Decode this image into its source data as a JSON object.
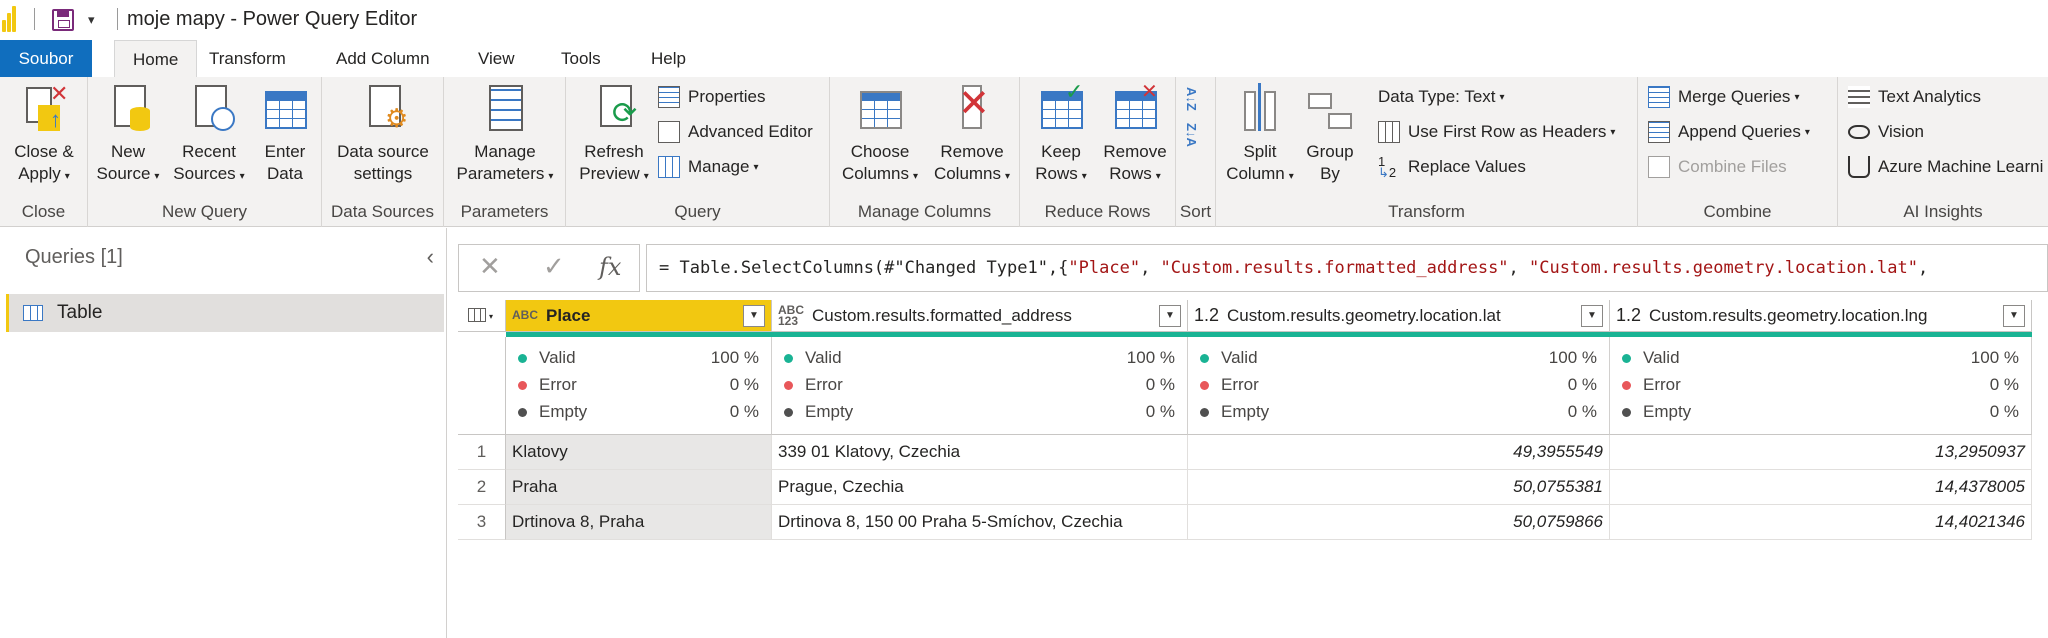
{
  "titlebar": {
    "title": "moje mapy - Power Query Editor",
    "dropdown_glyph": "▾"
  },
  "menu": {
    "tabs": [
      "Soubor",
      "Home",
      "Transform",
      "Add Column",
      "View",
      "Tools",
      "Help"
    ],
    "active": "Home"
  },
  "ribbon": {
    "close": {
      "label": "Close",
      "apply_l1": "Close &",
      "apply_l2": "Apply"
    },
    "new_query": {
      "label": "New Query",
      "new_l1": "New",
      "new_l2": "Source",
      "recent_l1": "Recent",
      "recent_l2": "Sources",
      "enter_l1": "Enter",
      "enter_l2": "Data"
    },
    "data_sources": {
      "label": "Data Sources",
      "btn_l1": "Data source",
      "btn_l2": "settings"
    },
    "parameters": {
      "label": "Parameters",
      "btn_l1": "Manage",
      "btn_l2": "Parameters"
    },
    "query": {
      "label": "Query",
      "refresh_l1": "Refresh",
      "refresh_l2": "Preview",
      "properties": "Properties",
      "advanced_editor": "Advanced Editor",
      "manage": "Manage"
    },
    "manage_columns": {
      "label": "Manage Columns",
      "choose_l1": "Choose",
      "choose_l2": "Columns",
      "remove_l1": "Remove",
      "remove_l2": "Columns"
    },
    "reduce_rows": {
      "label": "Reduce Rows",
      "keep_l1": "Keep",
      "keep_l2": "Rows",
      "remove_l1": "Remove",
      "remove_l2": "Rows"
    },
    "sort": {
      "label": "Sort",
      "az": "A↓Z",
      "za": "Z↓A"
    },
    "transform": {
      "label": "Transform",
      "split_l1": "Split",
      "split_l2": "Column",
      "group_l1": "Group",
      "group_l2": "By",
      "data_type": "Data Type: Text",
      "first_row": "Use First Row as Headers",
      "replace": "Replace Values",
      "replace_prefix": "1",
      "replace_sub": "2"
    },
    "combine": {
      "label": "Combine",
      "merge": "Merge Queries",
      "append": "Append Queries",
      "combine_files": "Combine Files"
    },
    "ai": {
      "label": "AI Insights",
      "text_analytics": "Text Analytics",
      "vision": "Vision",
      "azure_ml": "Azure Machine Learni"
    }
  },
  "queries": {
    "heading": "Queries [1]",
    "collapse": "‹",
    "items": [
      {
        "name": "Table"
      }
    ]
  },
  "formula": {
    "cancel": "✕",
    "confirm": "✓",
    "fx": "fx",
    "prefix": "= Table.SelectColumns(#\"Changed Type1\",{",
    "s1": "\"Place\"",
    "comma1": ", ",
    "s2": "\"Custom.results.formatted_address\"",
    "comma2": ", ",
    "s3": "\"Custom.results.geometry.location.lat\"",
    "comma3": ","
  },
  "grid": {
    "columns": [
      {
        "type": "ABC",
        "name": "Place"
      },
      {
        "type": "ABC 123",
        "type_l1": "ABC",
        "type_l2": "123",
        "name": "Custom.results.formatted_address"
      },
      {
        "type": "1.2",
        "name": "Custom.results.geometry.location.lat"
      },
      {
        "type": "1.2",
        "name": "Custom.results.geometry.location.lng"
      }
    ],
    "quality": {
      "valid_label": "Valid",
      "error_label": "Error",
      "empty_label": "Empty",
      "valid_pct": "100 %",
      "error_pct": "0 %",
      "empty_pct": "0 %"
    },
    "rows": [
      {
        "n": "1",
        "place": "Klatovy",
        "address": "339 01 Klatovy, Czechia",
        "lat": "49,3955549",
        "lng": "13,2950937"
      },
      {
        "n": "2",
        "place": "Praha",
        "address": "Prague, Czechia",
        "lat": "50,0755381",
        "lng": "14,4378005"
      },
      {
        "n": "3",
        "place": "Drtinova 8, Praha",
        "address": "Drtinova 8, 150 00 Praha 5-Smíchov, Czechia",
        "lat": "50,0759866",
        "lng": "14,4021346"
      }
    ]
  },
  "colors": {
    "accent_yellow": "#f2c811",
    "file_tab": "#106ebe",
    "valid": "#1ab394",
    "error": "#e8575a",
    "empty": "#505050"
  }
}
